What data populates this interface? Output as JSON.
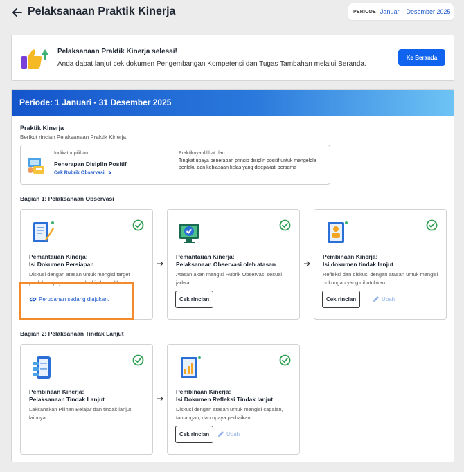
{
  "header": {
    "title": "Pelaksanaan Praktik Kinerja",
    "period_label": "PERIODE",
    "period_value": "Januari - Desember 2025"
  },
  "banner": {
    "title": "Pelaksanaan Praktik Kinerja selesai!",
    "description": "Anda dapat lanjut cek dokumen Pengembangan Kompetensi dan Tugas Tambahan melalui Beranda.",
    "button": "Ke Beranda"
  },
  "main": {
    "period_heading": "Periode: 1 Januari - 31 Desember 2025",
    "pk_title": "Praktik Kinerja",
    "pk_desc": "Berikut rincian Pelaksanaan Praktik Kinerja.",
    "indikator_label": "Indikator pilihan:",
    "indikator_value": "Penerapan Disiplin Positif",
    "rubrik_link": "Cek Rubrik Observasi",
    "praktik_label": "Praktiknya dilihat dari:",
    "praktik_value": "Tingkat upaya penerapan prinsip disiplin positif untuk mengelola perilaku dan kebiasaan kelas yang disepakati bersama"
  },
  "bagian1": {
    "title": "Bagian 1: Pelaksanaan Observasi",
    "cards": [
      {
        "title1": "Pemantauan Kinerja:",
        "title2": "Isi Dokumen Persiapan",
        "desc": "Diskusi dengan atasan untuk mengisi target perilaku, upaya memperbaiki, dan indikasi.",
        "link": "Perubahan sedang diajukan."
      },
      {
        "title1": "Pemantauan Kinerja:",
        "title2": "Pelaksanaan Observasi oleh atasan",
        "desc": "Atasan akan mengisi Rubrik Observasi sesuai jadwal.",
        "button": "Cek rincian"
      },
      {
        "title1": "Pembinaan Kinerja:",
        "title2": "Isi dokumen tindak lanjut",
        "desc": "Refleksi dan diskusi dengan atasan untuk mengisi dukungan yang dibutuhkan.",
        "button": "Cek rincian",
        "edit": "Ubah"
      }
    ]
  },
  "bagian2": {
    "title": "Bagian 2: Pelaksanaan Tindak Lanjut",
    "cards": [
      {
        "title1": "Pembinaan Kinerja:",
        "title2": "Pelaksanaan Tindak Lanjut",
        "desc": "Laksanakan Pilihan Belajar dan tindak lanjut lainnya."
      },
      {
        "title1": "Pembinaan Kinerja:",
        "title2": "Isi Dokumen Refleksi Tindak lanjut",
        "desc": "Diskusi dengan atasan untuk mengisi capaian, tantangan, dan upaya perbaikan.",
        "button": "Cek rincian",
        "edit": "Ubah"
      }
    ]
  },
  "colors": {
    "primary": "#0f63ee",
    "check": "#2e9e4f",
    "highlight": "#f58a2c",
    "link": "#1a56c9"
  },
  "icons": [
    "arrow-left-icon",
    "thumbs-up-icon",
    "check-circle-icon",
    "arrow-right-icon",
    "link-icon",
    "pencil-icon",
    "chevron-right-icon"
  ]
}
